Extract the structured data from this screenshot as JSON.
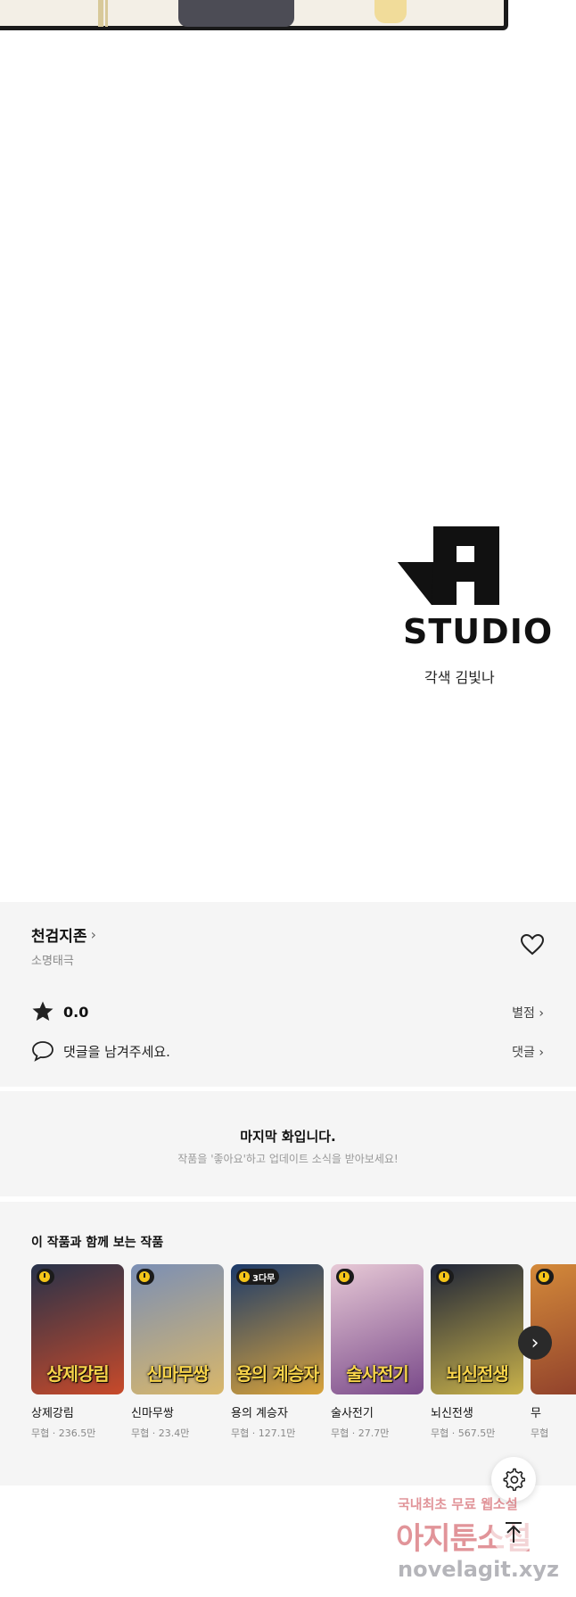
{
  "studio": {
    "wordmark": "STUDIO",
    "credit": "각색 김빛나"
  },
  "series": {
    "title": "천검지존",
    "author": "소명태극",
    "rating": "0.0",
    "rate_label": "별점",
    "comment_prompt": "댓글을 남겨주세요.",
    "comment_label": "댓글"
  },
  "last_episode": {
    "heading": "마지막 화입니다.",
    "subtext": "작품을 '좋아요'하고 업데이트 소식을 받아보세요!"
  },
  "recommendations": {
    "heading": "이 작품과 함께 보는 작품",
    "items": [
      {
        "name": "상제강림",
        "meta": "무협 · 236.5만",
        "cover_text": "상제강림",
        "badge": "",
        "colors": [
          "#27324a",
          "#c84a2a"
        ]
      },
      {
        "name": "신마무쌍",
        "meta": "무협 · 23.4만",
        "cover_text": "신마무쌍",
        "badge": "",
        "colors": [
          "#7b8fb5",
          "#d9b76a"
        ]
      },
      {
        "name": "용의 계승자",
        "meta": "무협 · 127.1만",
        "cover_text": "용의 계승자",
        "badge": "3다무",
        "colors": [
          "#1c3a6a",
          "#d9a33a"
        ]
      },
      {
        "name": "술사전기",
        "meta": "무협 · 27.7만",
        "cover_text": "술사전기",
        "badge": "",
        "colors": [
          "#e7c9d6",
          "#7a4a8a"
        ]
      },
      {
        "name": "뇌신전생",
        "meta": "무협 · 567.5만",
        "cover_text": "뇌신전생",
        "badge": "",
        "colors": [
          "#1e2438",
          "#c9b24a"
        ]
      },
      {
        "name": "무",
        "meta": "무협",
        "cover_text": "",
        "badge": "",
        "colors": [
          "#d48a3a",
          "#8a3a2a"
        ]
      }
    ]
  },
  "watermark": {
    "line1": "국내최초 무료 웹소설",
    "line2": "아지툰소설",
    "line3": "novelagit.xyz"
  },
  "icons": {
    "settings": "gear-icon",
    "scroll_top": "arrow-up-icon",
    "next": "chevron-right-icon"
  }
}
